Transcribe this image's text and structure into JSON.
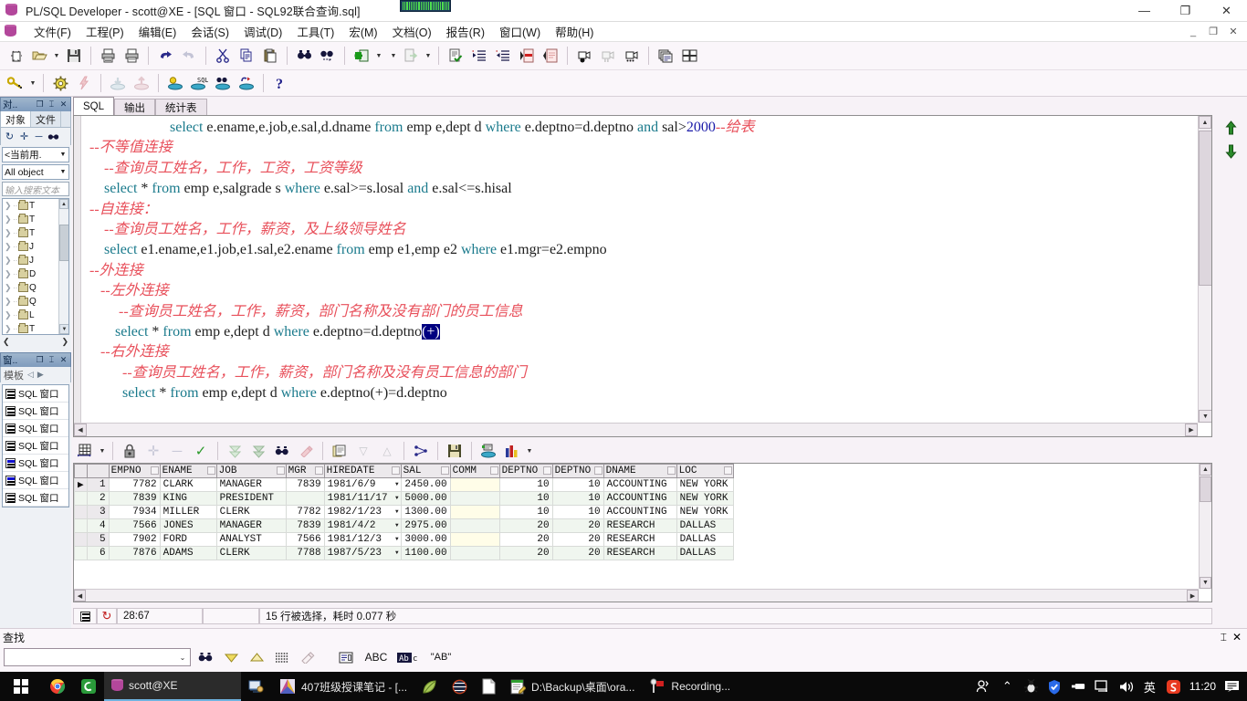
{
  "titlebar": {
    "title": "PL/SQL Developer - scott@XE - [SQL 窗口 - SQL92联合查询.sql]",
    "icon": "plsql-database-icon",
    "minimize": "—",
    "maximize": "❐",
    "close": "✕"
  },
  "menubar": {
    "items": [
      {
        "label": "文件(F)",
        "name": "menu-file"
      },
      {
        "label": "工程(P)",
        "name": "menu-project"
      },
      {
        "label": "编辑(E)",
        "name": "menu-edit"
      },
      {
        "label": "会话(S)",
        "name": "menu-session"
      },
      {
        "label": "调试(D)",
        "name": "menu-debug"
      },
      {
        "label": "工具(T)",
        "name": "menu-tools"
      },
      {
        "label": "宏(M)",
        "name": "menu-macro"
      },
      {
        "label": "文档(O)",
        "name": "menu-document"
      },
      {
        "label": "报告(R)",
        "name": "menu-report"
      },
      {
        "label": "窗口(W)",
        "name": "menu-window"
      },
      {
        "label": "帮助(H)",
        "name": "menu-help"
      }
    ],
    "mdi_minimize": "_",
    "mdi_restore": "❐",
    "mdi_close": "✕"
  },
  "object_browser": {
    "panel_title": "对.. ",
    "pin": "⌶",
    "close": "✕",
    "restore": "❐",
    "tabs": [
      {
        "label": "对象",
        "active": true
      },
      {
        "label": "文件",
        "active": false
      }
    ],
    "mini_buttons": [
      "refresh-icon",
      "expand-icon",
      "collapse-icon",
      "find-icon"
    ],
    "user_filter": "<当前用.",
    "object_filter": "All object",
    "search_placeholder": "输入搜索文本",
    "tree_items": [
      "T",
      "T",
      "T",
      "J",
      "J",
      "D",
      "Q",
      "Q",
      "L",
      "T"
    ]
  },
  "window_list": {
    "panel_title": "窗.. ",
    "pin": "⌶",
    "close": "✕",
    "restore": "❐",
    "template_label": "模板",
    "items": [
      {
        "label": "SQL 窗口",
        "blue": false
      },
      {
        "label": "SQL 窗口",
        "blue": false
      },
      {
        "label": "SQL 窗口",
        "blue": false
      },
      {
        "label": "SQL 窗口",
        "blue": false
      },
      {
        "label": "SQL 窗口",
        "blue": true
      },
      {
        "label": "SQL 窗口",
        "blue": true
      },
      {
        "label": "SQL 窗口",
        "blue": false
      }
    ]
  },
  "editor": {
    "tabs": [
      {
        "label": "SQL",
        "active": true
      },
      {
        "label": "输出",
        "active": false
      },
      {
        "label": "统计表",
        "active": false
      }
    ],
    "lines": [
      {
        "indent": 24,
        "parts": [
          {
            "t": "select",
            "c": "kw"
          },
          {
            "t": " e.ename,e.job,e.sal,d.dname ",
            "c": ""
          },
          {
            "t": "from",
            "c": "kw"
          },
          {
            "t": " emp e,dept d ",
            "c": ""
          },
          {
            "t": "where",
            "c": "kw"
          },
          {
            "t": " e.deptno=d.deptno ",
            "c": ""
          },
          {
            "t": "and",
            "c": "kw"
          },
          {
            "t": " sal>",
            "c": ""
          },
          {
            "t": "2000",
            "c": "num"
          },
          {
            "t": "--给表",
            "c": "cm"
          }
        ]
      },
      {
        "indent": 2,
        "parts": [
          {
            "t": "--不等值连接",
            "c": "cm"
          }
        ]
      },
      {
        "indent": 6,
        "parts": [
          {
            "t": "--查询员工姓名，工作，工资，工资等级",
            "c": "cm"
          }
        ]
      },
      {
        "indent": 6,
        "parts": [
          {
            "t": "select",
            "c": "kw"
          },
          {
            "t": " * ",
            "c": ""
          },
          {
            "t": "from",
            "c": "kw"
          },
          {
            "t": " emp e,salgrade s ",
            "c": ""
          },
          {
            "t": "where",
            "c": "kw"
          },
          {
            "t": " e.sal>=s.losal ",
            "c": ""
          },
          {
            "t": "and",
            "c": "kw"
          },
          {
            "t": " e.sal<=s.hisal",
            "c": ""
          }
        ]
      },
      {
        "indent": 2,
        "parts": [
          {
            "t": "--自连接：",
            "c": "cm"
          }
        ]
      },
      {
        "indent": 6,
        "parts": [
          {
            "t": "--查询员工姓名，工作，薪资，及上级领导姓名",
            "c": "cm"
          }
        ]
      },
      {
        "indent": 6,
        "parts": [
          {
            "t": "select",
            "c": "kw"
          },
          {
            "t": " e1.ename,e1.job,e1.sal,e2.ename ",
            "c": ""
          },
          {
            "t": "from",
            "c": "kw"
          },
          {
            "t": " emp e1,emp e2 ",
            "c": ""
          },
          {
            "t": "where",
            "c": "kw"
          },
          {
            "t": " e1.mgr=e2.empno",
            "c": ""
          }
        ]
      },
      {
        "indent": 2,
        "parts": [
          {
            "t": "--外连接",
            "c": "cm"
          }
        ]
      },
      {
        "indent": 5,
        "parts": [
          {
            "t": "--左外连接",
            "c": "cm"
          }
        ]
      },
      {
        "indent": 10,
        "parts": [
          {
            "t": "--查询员工姓名，工作，薪资，部门名称及没有部门的员工信息",
            "c": "cm"
          }
        ]
      },
      {
        "indent": 9,
        "parts": [
          {
            "t": "select",
            "c": "kw"
          },
          {
            "t": " * ",
            "c": ""
          },
          {
            "t": "from",
            "c": "kw"
          },
          {
            "t": " emp e,dept d ",
            "c": ""
          },
          {
            "t": "where",
            "c": "kw"
          },
          {
            "t": " e.deptno=d.deptno",
            "c": ""
          },
          {
            "t": "(+)",
            "c": "sel"
          }
        ]
      },
      {
        "indent": 5,
        "parts": [
          {
            "t": "--右外连接",
            "c": "cm"
          }
        ]
      },
      {
        "indent": 11,
        "parts": [
          {
            "t": "--查询员工姓名，工作，薪资，部门名称及没有员工信息的部门",
            "c": "cm"
          }
        ]
      },
      {
        "indent": 11,
        "parts": [
          {
            "t": "select",
            "c": "kw"
          },
          {
            "t": " * ",
            "c": ""
          },
          {
            "t": "from",
            "c": "kw"
          },
          {
            "t": " emp e,dept d ",
            "c": ""
          },
          {
            "t": "where",
            "c": "kw"
          },
          {
            "t": " e.deptno(+)=d.deptno",
            "c": ""
          }
        ]
      }
    ]
  },
  "grid": {
    "columns": [
      "EMPNO",
      "ENAME",
      "JOB",
      "MGR",
      "HIREDATE",
      "SAL",
      "COMM",
      "DEPTNO",
      "DEPTNO",
      "DNAME",
      "LOC"
    ],
    "rows": [
      {
        "n": "1",
        "marker": "▶",
        "cells": [
          "7782",
          "CLARK",
          "MANAGER",
          "7839",
          "1981/6/9",
          "2450.00",
          "",
          "10",
          "10",
          "ACCOUNTING",
          "NEW YORK"
        ]
      },
      {
        "n": "2",
        "marker": "",
        "cells": [
          "7839",
          "KING",
          "PRESIDENT",
          "",
          "1981/11/17",
          "5000.00",
          "",
          "10",
          "10",
          "ACCOUNTING",
          "NEW YORK"
        ]
      },
      {
        "n": "3",
        "marker": "",
        "cells": [
          "7934",
          "MILLER",
          "CLERK",
          "7782",
          "1982/1/23",
          "1300.00",
          "",
          "10",
          "10",
          "ACCOUNTING",
          "NEW YORK"
        ]
      },
      {
        "n": "4",
        "marker": "",
        "cells": [
          "7566",
          "JONES",
          "MANAGER",
          "7839",
          "1981/4/2",
          "2975.00",
          "",
          "20",
          "20",
          "RESEARCH",
          "DALLAS"
        ]
      },
      {
        "n": "5",
        "marker": "",
        "cells": [
          "7902",
          "FORD",
          "ANALYST",
          "7566",
          "1981/12/3",
          "3000.00",
          "",
          "20",
          "20",
          "RESEARCH",
          "DALLAS"
        ]
      },
      {
        "n": "6",
        "marker": "",
        "cells": [
          "7876",
          "ADAMS",
          "CLERK",
          "7788",
          "1987/5/23",
          "1100.00",
          "",
          "20",
          "20",
          "RESEARCH",
          "DALLAS"
        ]
      }
    ]
  },
  "statusbar": {
    "cursor_position": "28:67",
    "result_message": "15 行被选择，耗时 0.077 秒"
  },
  "findbar": {
    "title": "查找",
    "input_value": "",
    "buttons": [
      "find-icon",
      "find-next-icon",
      "find-prev-icon",
      "highlight-all-icon",
      "clear-icon",
      "options-icon",
      "match-case-icon",
      "whole-word-icon",
      "regex-icon"
    ],
    "abc_label": "ABC",
    "ab_label": "AB",
    "quote_label": "\"AB\"",
    "pin": "⌶",
    "close": "✕"
  },
  "taskbar": {
    "start": "windows-logo",
    "apps": [
      {
        "label": "scott@XE",
        "icon": "plsql-icon",
        "active": true,
        "wide": true
      },
      {
        "label": "",
        "icon": "remote-icon",
        "active": false,
        "wide": false
      },
      {
        "label": "407班级授课笔记 - [...",
        "icon": "xmind-icon",
        "active": false,
        "wide": true
      },
      {
        "label": "",
        "icon": "leaf-icon",
        "active": false,
        "wide": false
      },
      {
        "label": "",
        "icon": "globe-icon",
        "active": false,
        "wide": false
      },
      {
        "label": "",
        "icon": "doc-icon",
        "active": false,
        "wide": false
      },
      {
        "label": "D:\\Backup\\桌面\\ora...",
        "icon": "notepad-icon",
        "active": false,
        "wide": true
      },
      {
        "label": "Recording...",
        "icon": "recorder-icon",
        "active": false,
        "wide": true
      }
    ],
    "tray": [
      "people-icon",
      "chevron-up-icon",
      "ant-icon",
      "shield-icon",
      "usb-icon",
      "network-icon",
      "volume-icon"
    ],
    "ime": "英",
    "sogou": "S",
    "clock": "11:20",
    "notification": "notification-icon"
  },
  "colors": {
    "keyword": "#1a7a8c",
    "comment": "#e8505b",
    "number": "#1a1aa8",
    "selection": "#000080",
    "titlebar_bg": "#ffffff",
    "toolbar_bg": "#faf6fa",
    "panel_head": "#7f9bbd",
    "taskbar_bg": "#0a0a0a",
    "alt_row": "#f0f6ef"
  }
}
